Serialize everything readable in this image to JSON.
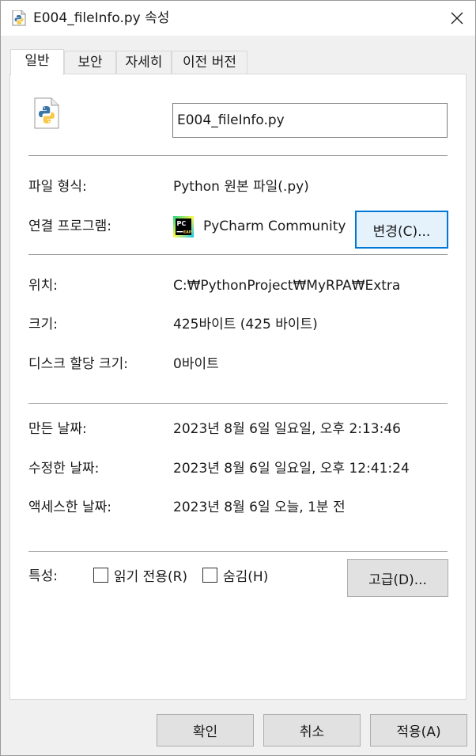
{
  "window": {
    "title": "E004_fileInfo.py 속성",
    "close_glyph": "✕"
  },
  "tabs": [
    {
      "label": "일반",
      "active": true
    },
    {
      "label": "보안",
      "active": false
    },
    {
      "label": "자세히",
      "active": false
    },
    {
      "label": "이전 버전",
      "active": false
    }
  ],
  "file": {
    "name_value": "E004_fileInfo.py",
    "icon": "python-file-icon"
  },
  "type_section": {
    "file_type_label": "파일 형식:",
    "file_type_value": "Python 원본 파일(.py)",
    "opens_with_label": "연결 프로그램:",
    "opens_with_value": "PyCharm Community Edition",
    "opens_with_icon": "pycharm-icon",
    "pycharm_icon_top": "PC",
    "pycharm_icon_bottom": "EAP",
    "change_button": "변경(C)..."
  },
  "location_section": {
    "location_label": "위치:",
    "location_value": "C:₩PythonProject₩MyRPA₩Extra",
    "size_label": "크기:",
    "size_value": "425바이트 (425 바이트)",
    "disk_size_label": "디스크 할당 크기:",
    "disk_size_value": "0바이트"
  },
  "dates_section": {
    "created_label": "만든 날짜:",
    "created_value": "2023년 8월 6일 일요일, 오후 2:13:46",
    "modified_label": "수정한 날짜:",
    "modified_value": "2023년 8월 6일 일요일, 오후 12:41:24",
    "accessed_label": "액세스한 날짜:",
    "accessed_value": "2023년 8월 6일 오늘, 1분 전"
  },
  "attributes_section": {
    "label": "특성:",
    "readonly_label": "읽기 전용(R)",
    "readonly_checked": false,
    "hidden_label": "숨김(H)",
    "hidden_checked": false,
    "advanced_button": "고급(D)..."
  },
  "footer": {
    "ok_button": "확인",
    "cancel_button": "취소",
    "apply_button": "적용(A)"
  },
  "colors": {
    "focus_accent": "#0078d7",
    "python_blue": "#3a75a8",
    "python_yellow": "#f7c948",
    "pycharm_green": "#21d789"
  }
}
